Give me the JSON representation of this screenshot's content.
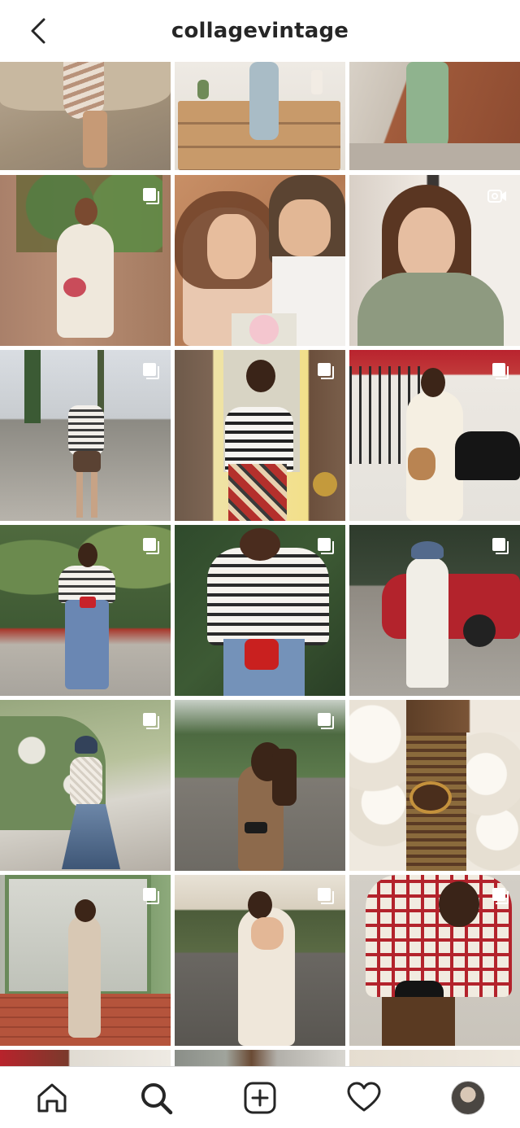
{
  "header": {
    "title": "collagevintage",
    "back_icon": "chevron-left-icon"
  },
  "grid": {
    "badge_icons": {
      "carousel": "carousel-icon",
      "video": "video-icon"
    }
  },
  "nav": {
    "items": [
      {
        "name": "home-icon"
      },
      {
        "name": "search-icon"
      },
      {
        "name": "add-post-icon"
      },
      {
        "name": "heart-icon"
      },
      {
        "name": "profile-avatar"
      }
    ]
  },
  "colors": {
    "text": "#262626",
    "divider": "#dbdbdb",
    "background": "#ffffff"
  }
}
